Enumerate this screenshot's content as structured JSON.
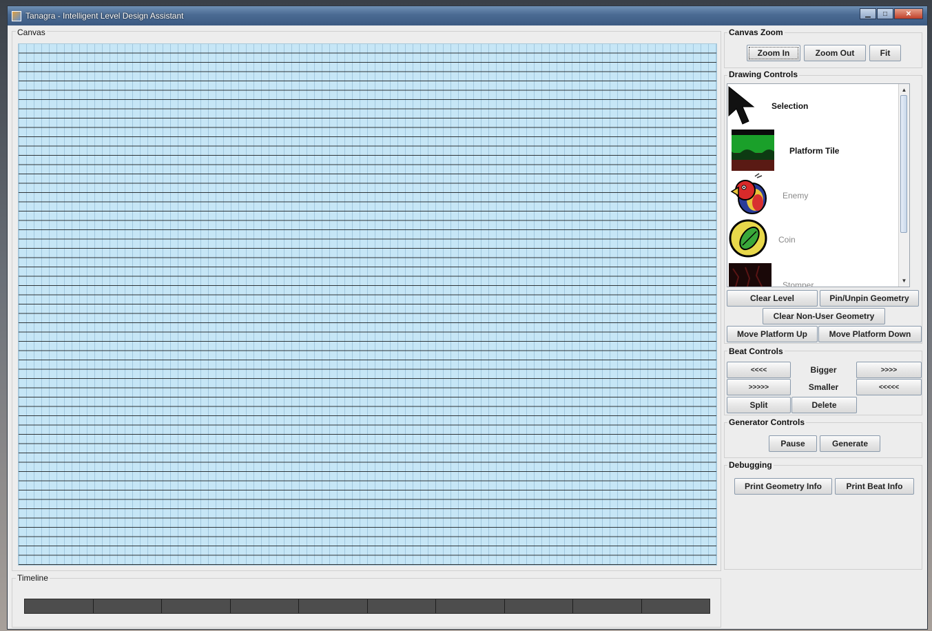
{
  "window": {
    "title": "Tanagra - Intelligent Level Design Assistant",
    "minimize_glyph": "▁",
    "maximize_glyph": "□",
    "close_glyph": "✕"
  },
  "canvas": {
    "label": "Canvas"
  },
  "timeline": {
    "label": "Timeline",
    "segments": 10
  },
  "zoom": {
    "label": "Canvas Zoom",
    "zoom_in": "Zoom In",
    "zoom_out": "Zoom Out",
    "fit": "Fit"
  },
  "drawing": {
    "label": "Drawing Controls",
    "tools": [
      {
        "name": "Selection",
        "icon": "arrow-cursor-icon",
        "enabled": true
      },
      {
        "name": "Platform Tile",
        "icon": "platform-tile-icon",
        "enabled": true
      },
      {
        "name": "Enemy",
        "icon": "bird-enemy-icon",
        "enabled": false
      },
      {
        "name": "Coin",
        "icon": "leaf-coin-icon",
        "enabled": false
      },
      {
        "name": "Stomper",
        "icon": "stomper-icon",
        "enabled": false
      }
    ],
    "clear_level": "Clear Level",
    "pin_unpin": "Pin/Unpin Geometry",
    "clear_non_user": "Clear Non-User Geometry",
    "move_up": "Move Platform Up",
    "move_down": "Move Platform Down"
  },
  "beat": {
    "label": "Beat Controls",
    "bigger_left": "<<<<",
    "bigger": "Bigger",
    "bigger_right": ">>>>",
    "smaller_left": ">>>>>",
    "smaller": "Smaller",
    "smaller_right": "<<<<<",
    "split": "Split",
    "delete": "Delete"
  },
  "generator": {
    "label": "Generator Controls",
    "pause": "Pause",
    "generate": "Generate"
  },
  "debug": {
    "label": "Debugging",
    "print_geometry": "Print Geometry Info",
    "print_beat": "Print Beat Info"
  }
}
